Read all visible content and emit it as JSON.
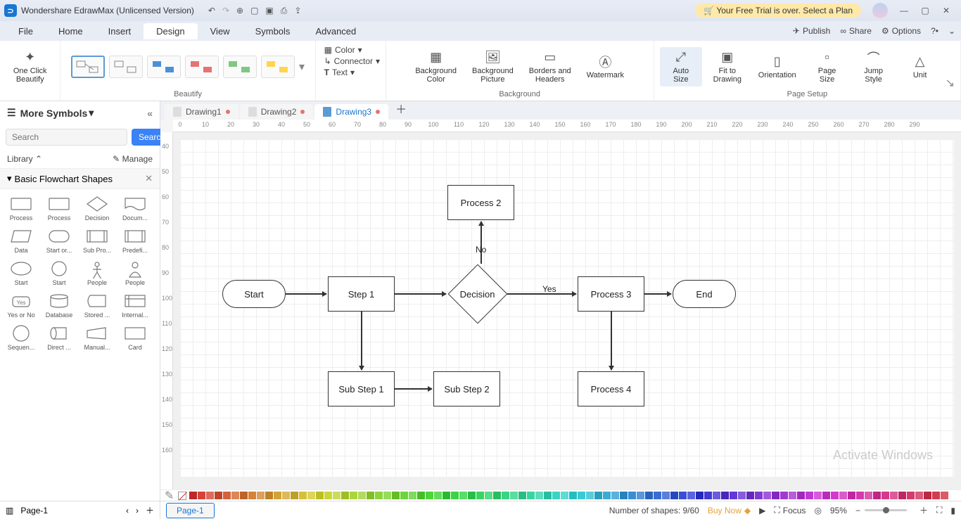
{
  "titlebar": {
    "app_title": "Wondershare EdrawMax (Unlicensed Version)",
    "trial_msg": "Your Free Trial is over. Select a Plan"
  },
  "menus": [
    "File",
    "Home",
    "Insert",
    "Design",
    "View",
    "Symbols",
    "Advanced"
  ],
  "active_menu": "Design",
  "topright": {
    "publish": "Publish",
    "share": "Share",
    "options": "Options"
  },
  "ribbon": {
    "beautify_btn": "One Click\nBeautify",
    "group_beautify": "Beautify",
    "color": "Color",
    "connector": "Connector",
    "text": "Text",
    "bg_color": "Background\nColor",
    "bg_pic": "Background\nPicture",
    "borders": "Borders and\nHeaders",
    "watermark": "Watermark",
    "group_background": "Background",
    "autosize": "Auto\nSize",
    "fit": "Fit to\nDrawing",
    "orientation": "Orientation",
    "pagesize": "Page\nSize",
    "jumpstyle": "Jump\nStyle",
    "unit": "Unit",
    "group_page": "Page Setup"
  },
  "left": {
    "more_symbols": "More Symbols",
    "search_placeholder": "Search",
    "search_btn": "Search",
    "library": "Library",
    "manage": "Manage",
    "category": "Basic Flowchart Shapes",
    "shapes": [
      [
        "Process",
        "Process",
        "Decision",
        "Docum..."
      ],
      [
        "Data",
        "Start or...",
        "Sub Pro...",
        "Predefi..."
      ],
      [
        "Start",
        "Start",
        "People",
        "People"
      ],
      [
        "Yes or No",
        "Database",
        "Stored ...",
        "Internal..."
      ],
      [
        "Sequen...",
        "Direct ...",
        "Manual...",
        "Card"
      ]
    ]
  },
  "tabs": [
    {
      "name": "Drawing1",
      "mod": true
    },
    {
      "name": "Drawing2",
      "mod": true
    },
    {
      "name": "Drawing3",
      "mod": true
    }
  ],
  "active_tab": 2,
  "rulerH": [
    0,
    10,
    20,
    30,
    40,
    50,
    60,
    70,
    80,
    90,
    100,
    110,
    120,
    130,
    140,
    150,
    160,
    170,
    180,
    190,
    200,
    210,
    220,
    230,
    240,
    250,
    260,
    270,
    280,
    290
  ],
  "rulerV": [
    40,
    50,
    60,
    70,
    80,
    90,
    100,
    110,
    120,
    130,
    140,
    150,
    160
  ],
  "flow": {
    "start": "Start",
    "step1": "Step 1",
    "sub1": "Sub Step 1",
    "sub2": "Sub Step 2",
    "decision": "Decision",
    "proc2": "Process 2",
    "proc3": "Process 3",
    "proc4": "Process 4",
    "end": "End",
    "yes": "Yes",
    "no": "No"
  },
  "watermark": "Activate Windows",
  "status": {
    "page1_left": "Page-1",
    "page1": "Page-1",
    "shapes": "Number of shapes: 9/60",
    "buy": "Buy Now",
    "focus": "Focus",
    "zoom": "95%"
  }
}
